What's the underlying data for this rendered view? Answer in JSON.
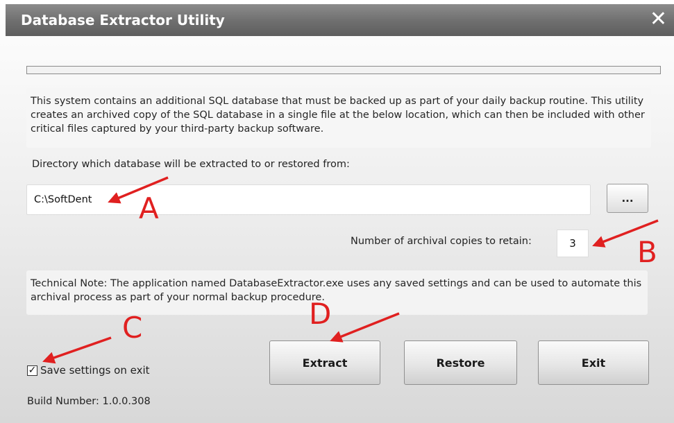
{
  "window": {
    "title": "Database Extractor Utility",
    "close_glyph": "✕"
  },
  "progress": {
    "value": 0
  },
  "description": "This system contains an additional SQL database that must be backed up as part of your daily backup routine. This utility creates an archived copy of the SQL database in a single file at the below location, which can then be included with other critical files captured by your third-party backup software.",
  "directory": {
    "label": "Directory which database will be extracted to or restored from:",
    "value": "C:\\SoftDent",
    "browse_label": "..."
  },
  "copies": {
    "label": "Number of archival copies to retain:",
    "value": "3"
  },
  "technical_note": "Technical Note:  The application named DatabaseExtractor.exe uses any saved settings and can be used to automate this archival process as part of your normal backup procedure.",
  "buttons": {
    "extract": "Extract",
    "restore": "Restore",
    "exit": "Exit"
  },
  "save_settings": {
    "label": "Save settings on exit",
    "checked": true,
    "check_glyph": "✓"
  },
  "build": "Build Number: 1.0.0.308",
  "annotations": {
    "color": "#e02020",
    "letters": [
      "A",
      "B",
      "C",
      "D"
    ]
  },
  "colors": {
    "titlebar": "#6e6e6e",
    "progress_fill": "#5aa0e0"
  }
}
